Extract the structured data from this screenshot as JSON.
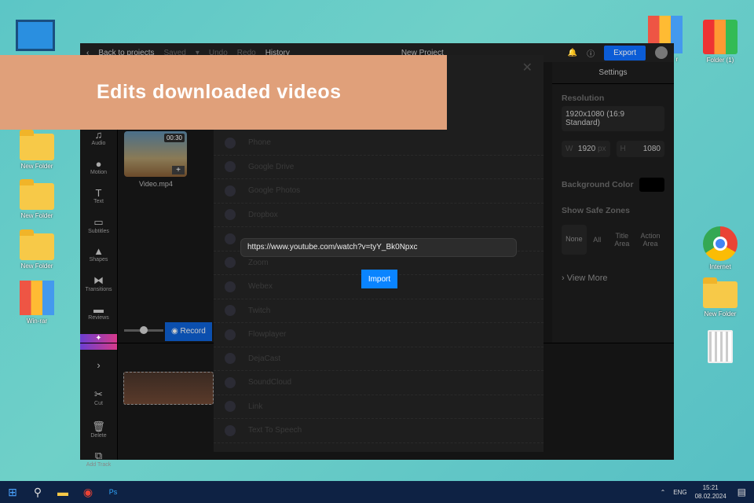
{
  "banner": "Edits downloaded videos",
  "desktop": {
    "left": [
      "New Folder",
      "New Folder",
      "New Folder",
      "Win-rar"
    ],
    "right": [
      "r",
      "Folder (1)",
      "Internet",
      "New Folder"
    ]
  },
  "topbar": {
    "back": "Back to projects",
    "saved": "Saved",
    "undo": "Undo",
    "redo": "Redo",
    "history": "History",
    "title": "New Project",
    "export": "Export"
  },
  "rail": [
    "Audio",
    "Motion",
    "Text",
    "Subtitles",
    "Shapes",
    "Transitions",
    "Reviews"
  ],
  "tools": [
    "Cut",
    "Delete",
    "Add Track"
  ],
  "media": {
    "duration": "00:30",
    "name": "Video.mp4",
    "record": "Record"
  },
  "modal": {
    "sources": [
      "Phone",
      "Google Drive",
      "Google Photos",
      "Dropbox",
      "",
      "Zoom",
      "Webex",
      "Twitch",
      "Flowplayer",
      "DejaCast",
      "SoundCloud",
      "Link",
      "Text To Speech"
    ],
    "url": "https://www.youtube.com/watch?v=tyY_Bk0Npxc",
    "import": "Import"
  },
  "settings": {
    "title": "Settings",
    "resolution_label": "Resolution",
    "resolution": "1920x1080 (16:9 Standard)",
    "w_label": "W",
    "w": "1920",
    "h_label": "H",
    "h": "1080",
    "unit": "px",
    "bg_label": "Background Color",
    "safe_label": "Show Safe Zones",
    "zones": [
      "None",
      "All",
      "Title Area",
      "Action Area"
    ],
    "view_more": "View More"
  },
  "taskbar": {
    "lang": "ENG",
    "time": "15:21",
    "date": "08.02.2024"
  }
}
